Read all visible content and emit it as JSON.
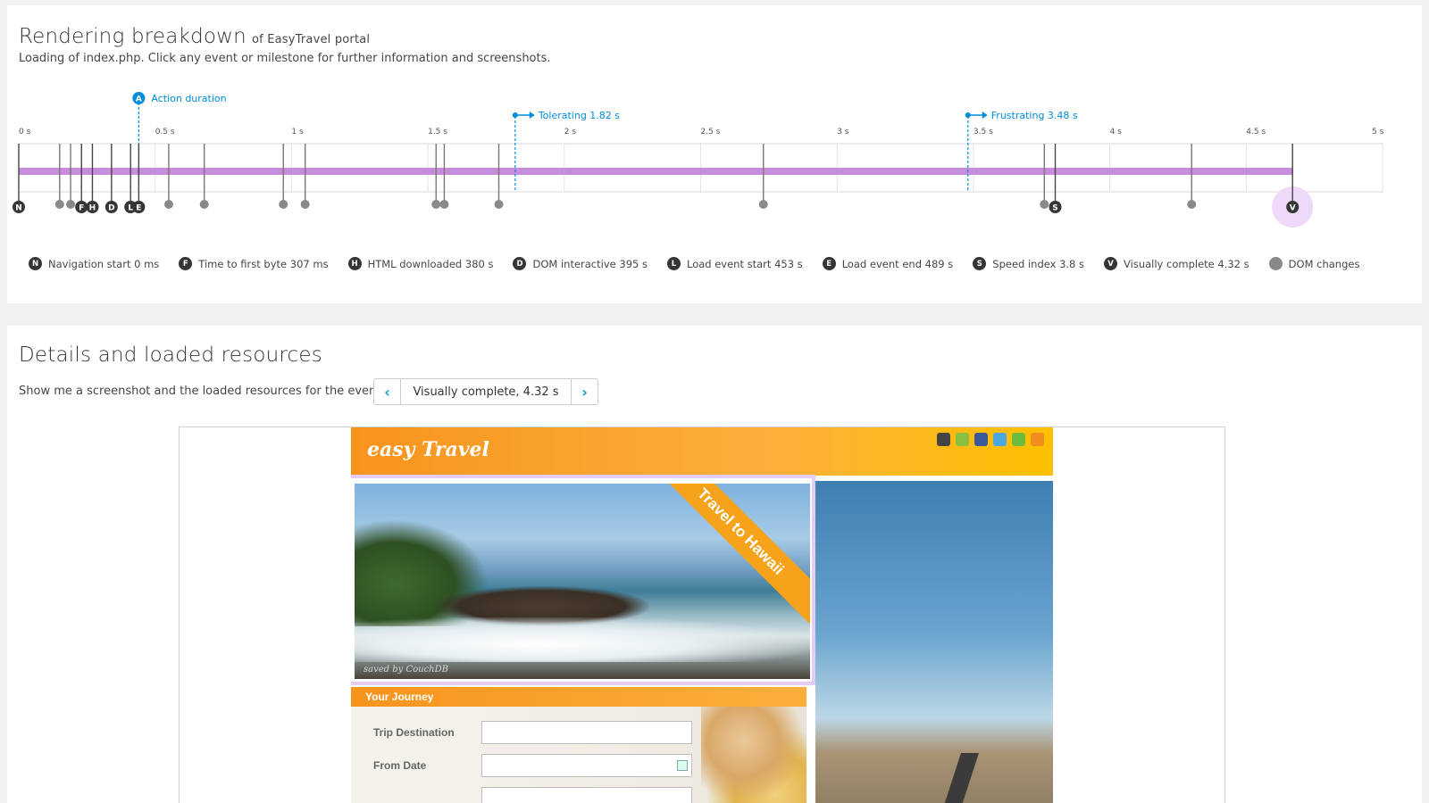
{
  "rendering": {
    "title": "Rendering breakdown",
    "title_suffix": "of EasyTravel portal",
    "subtitle": "Loading of index.php. Click any event or milestone for further information and screenshots."
  },
  "timeline": {
    "ticks": [
      "0 s",
      "0.5 s",
      "1 s",
      "1.5 s",
      "2 s",
      "2.5 s",
      "3 s",
      "3.5 s",
      "4 s",
      "4.5 s",
      "5 s"
    ],
    "tick_values": [
      0,
      0.5,
      1,
      1.5,
      2,
      2.5,
      3,
      3.5,
      4,
      4.5,
      5
    ],
    "action_duration": {
      "badge": "A",
      "label": "Action duration",
      "value_s": 0.44
    },
    "tolerating": {
      "label": "Tolerating 1.82 s",
      "value_s": 1.82
    },
    "frustrating": {
      "label": "Frustrating 3.48 s",
      "value_s": 3.48
    },
    "progress_end_s": 4.67,
    "milestones": [
      {
        "letter": "N",
        "value_s": 0.0
      },
      {
        "letter": "F",
        "value_s": 0.23
      },
      {
        "letter": "H",
        "value_s": 0.27
      },
      {
        "letter": "D",
        "value_s": 0.34
      },
      {
        "letter": "L",
        "value_s": 0.41
      },
      {
        "letter": "E",
        "value_s": 0.44
      },
      {
        "letter": "S",
        "value_s": 3.8
      },
      {
        "letter": "V",
        "value_s": 4.67
      }
    ],
    "dom_changes_s": [
      0.15,
      0.19,
      0.55,
      0.68,
      0.97,
      1.05,
      1.53,
      1.56,
      1.76,
      2.73,
      3.76,
      4.3
    ],
    "colors": {
      "accent": "#008cdb",
      "progress": "#c78ddc",
      "pin": "#353535",
      "dom": "#898989",
      "highlight": "#eed9f8"
    }
  },
  "legend": [
    {
      "badge": "N",
      "label": "Navigation start 0 ms"
    },
    {
      "badge": "F",
      "label": "Time to first byte 307 ms"
    },
    {
      "badge": "H",
      "label": "HTML downloaded 380 s"
    },
    {
      "badge": "D",
      "label": "DOM interactive 395 s"
    },
    {
      "badge": "L",
      "label": "Load event start 453 s"
    },
    {
      "badge": "E",
      "label": "Load event end 489 s"
    },
    {
      "badge": "S",
      "label": "Speed index 3.8 s"
    },
    {
      "badge": "V",
      "label": "Visually complete 4.32 s"
    },
    {
      "badge": "",
      "label": "DOM changes"
    }
  ],
  "details": {
    "title": "Details and loaded resources",
    "picker_label": "Show me a screenshot and the loaded resources for the event",
    "picker_value": "Visually complete, 4.32 s",
    "prev_icon": "chevron-left-icon",
    "next_icon": "chevron-right-icon"
  },
  "screenshot": {
    "logo": "easy Travel",
    "hero_banner": "Travel to Hawaii",
    "hero_credit": "saved by CouchDB",
    "journey_title": "Your Journey",
    "fields": [
      {
        "label": "Trip Destination"
      },
      {
        "label": "From Date"
      }
    ]
  }
}
